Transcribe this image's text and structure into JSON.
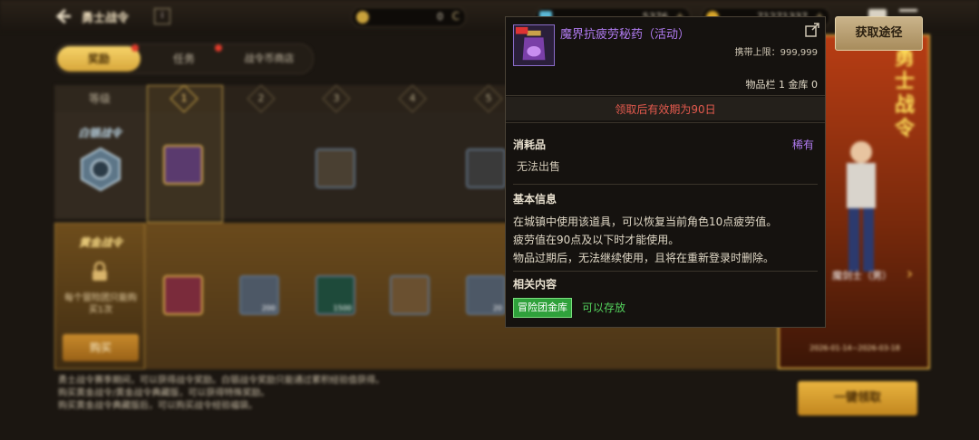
{
  "header": {
    "title": "勇士战令",
    "currencies": [
      {
        "name": "gold-coin",
        "value": "0",
        "color": "#c9a23c"
      },
      {
        "name": "gem",
        "value": "5376",
        "color": "#5ab8d6"
      },
      {
        "name": "coin",
        "value": "71271337",
        "color": "#d8a62a"
      }
    ]
  },
  "tabs": [
    {
      "label": "奖励",
      "active": true,
      "badge": true
    },
    {
      "label": "任务",
      "active": false,
      "badge": true
    },
    {
      "label": "战令币商店",
      "active": false,
      "badge": false
    }
  ],
  "grid": {
    "level_header": "等级",
    "levels": [
      "1",
      "2",
      "3",
      "4",
      "5"
    ],
    "free_pass": {
      "label": "白银战令"
    },
    "gold_pass": {
      "label": "黄金战令",
      "note": "每个冒险团只能购买1次",
      "buy_label": "购买"
    },
    "free_rewards": [
      {
        "level": "1",
        "icon": "potion-icon",
        "count": ""
      },
      {
        "level": "3",
        "icon": "coin-box-icon",
        "count": ""
      },
      {
        "level": "5",
        "icon": "ore-icon",
        "count": ""
      }
    ],
    "gold_rewards": [
      {
        "level": "1",
        "icon": "weapon-box-icon",
        "count": ""
      },
      {
        "level": "2",
        "icon": "crystal-icon",
        "count": "200"
      },
      {
        "level": "3",
        "icon": "emerald-icon",
        "count": "1500"
      },
      {
        "level": "4",
        "icon": "mystery-box-icon",
        "count": ""
      },
      {
        "level": "5",
        "icon": "crystal-icon",
        "count": "20"
      }
    ]
  },
  "description": [
    "勇士战令赛季期间，可以获得战令奖励。白银战令奖励只能通过累积经验值获得。",
    "购买黄金战令/黄金战令典藏版，可以获得特殊奖励。",
    "购买黄金战令典藏版后，可以购买战令经验福袋。"
  ],
  "claim_all_label": "一键领取",
  "get_path_label": "获取途径",
  "promo": {
    "title": "勇士战令",
    "character": "魔剑士（男）",
    "date_range": "2026-01-14~2026-03-18"
  },
  "tooltip": {
    "item_name": "魔界抗疲劳秘药（活动）",
    "carry_limit": "携带上限：999,999",
    "storage": "物品栏 1 金库 0",
    "expiry": "领取后有效期为90日",
    "category": "消耗品",
    "rarity": "稀有",
    "sellable": "无法出售",
    "basic_info_title": "基本信息",
    "basic_info_lines": [
      "在城镇中使用该道具，可以恢复当前角色10点疲劳值。",
      "疲劳值在90点及以下时才能使用。",
      "物品过期后，无法继续使用，且将在重新登录时删除。"
    ],
    "related_title": "相关内容",
    "related_tag": "冒险团金库",
    "related_note": "可以存放",
    "rarity_color": "#b07bf0",
    "expiry_color": "#e55a4e"
  }
}
